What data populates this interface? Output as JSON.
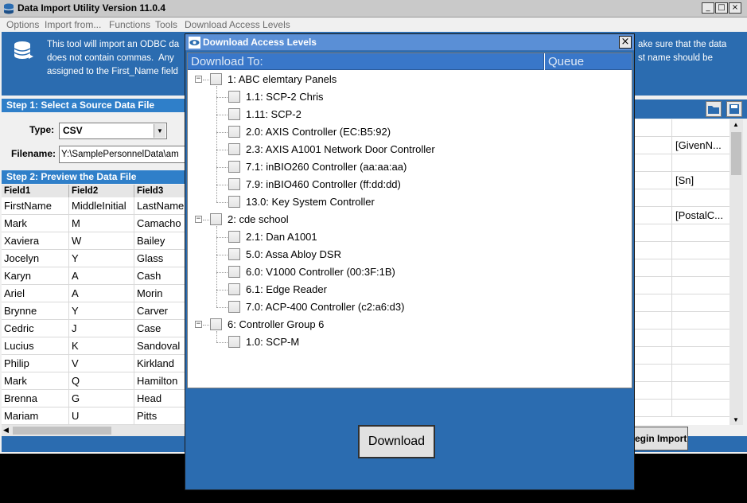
{
  "app": {
    "title": "Data Import Utility Version 11.0.4",
    "window_buttons": [
      "_",
      "□",
      "×"
    ]
  },
  "menu": [
    "Options",
    "Import from...",
    "Functions",
    "Tools",
    "Download Access Levels"
  ],
  "info": {
    "left_text": "This tool will import an ODBC da\ndoes not contain commas.  Any\nassigned to the First_Name field",
    "right_text": "ake sure that the data\nst name should be"
  },
  "step1": {
    "header": "Step 1:  Select a Source Data File",
    "type_label": "Type:",
    "type_value": "CSV",
    "filename_label": "Filename:",
    "filename_value": "Y:\\SamplePersonnelData\\am"
  },
  "step2": {
    "header": "Step 2:  Preview the Data File",
    "columns": [
      "Field1",
      "Field2",
      "Field3"
    ],
    "rows": [
      [
        "FirstName",
        "MiddleInitial",
        "LastName"
      ],
      [
        "Mark",
        "M",
        "Camacho"
      ],
      [
        "Xaviera",
        "W",
        "Bailey"
      ],
      [
        "Jocelyn",
        "Y",
        "Glass"
      ],
      [
        "Karyn",
        "A",
        "Cash"
      ],
      [
        "Ariel",
        "A",
        "Morin"
      ],
      [
        "Brynne",
        "Y",
        "Carver"
      ],
      [
        "Cedric",
        "J",
        "Case"
      ],
      [
        "Lucius",
        "K",
        "Sandoval"
      ],
      [
        "Philip",
        "V",
        "Kirkland"
      ],
      [
        "Mark",
        "Q",
        "Hamilton"
      ],
      [
        "Brenna",
        "G",
        "Head"
      ],
      [
        "Mariam",
        "U",
        "Pitts"
      ]
    ]
  },
  "mapping_grid": {
    "values": [
      "",
      "[GivenN...",
      "",
      "[Sn]",
      "",
      "[PostalC...",
      "",
      "",
      "",
      "",
      "",
      "",
      "",
      "",
      "",
      "",
      ""
    ]
  },
  "begin_import_label": "egin Import",
  "dialog": {
    "title": "Download Access Levels",
    "close_label": "×",
    "col_download_to": "Download To:",
    "col_queue": "Queue",
    "download_button": "Download",
    "groups": [
      {
        "label": "1:  ABC elemtary Panels",
        "children": [
          "1.1:  SCP-2 Chris",
          "1.11:  SCP-2",
          "2.0:  AXIS Controller (EC:B5:92)",
          "2.3:  AXIS A1001 Network Door Controller",
          "7.1:  inBIO260 Controller (aa:aa:aa)",
          "7.9:  inBIO460 Controller (ff:dd:dd)",
          "13.0:  Key System Controller"
        ]
      },
      {
        "label": "2:  cde school",
        "children": [
          "2.1:  Dan A1001",
          "5.0:  Assa Abloy DSR",
          "6.0:  V1000 Controller (00:3F:1B)",
          "6.1:  Edge Reader",
          "7.0:  ACP-400 Controller (c2:a6:d3)"
        ]
      },
      {
        "label": "6:  Controller Group 6",
        "children": [
          "1.0:  SCP-M"
        ]
      }
    ]
  },
  "colors": {
    "panel_blue": "#2b6cb0",
    "header_blue": "#3977c9",
    "dialog_title": "#5a8fd6"
  }
}
